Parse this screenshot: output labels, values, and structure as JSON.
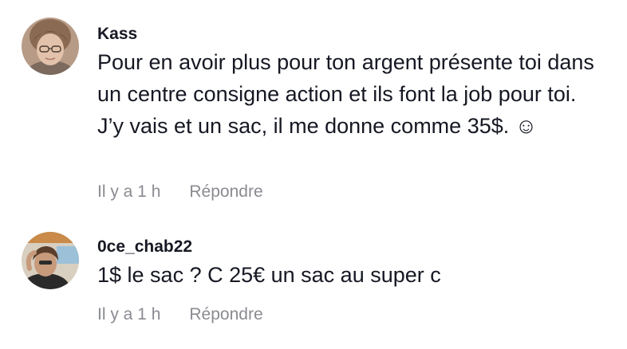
{
  "comments": [
    {
      "username": "Kass",
      "text": "Pour en avoir plus pour ton argent présente toi dans un centre consigne action et ils font la job pour toi. J’y vais et un sac, il me donne comme 35$. ☺",
      "time": "Il y a 1 h",
      "reply_label": "Répondre"
    },
    {
      "username": "0ce_chab22",
      "text": "1$ le sac ? C 25€ un sac au super c",
      "time": "Il y a 1 h",
      "reply_label": "Répondre"
    }
  ]
}
